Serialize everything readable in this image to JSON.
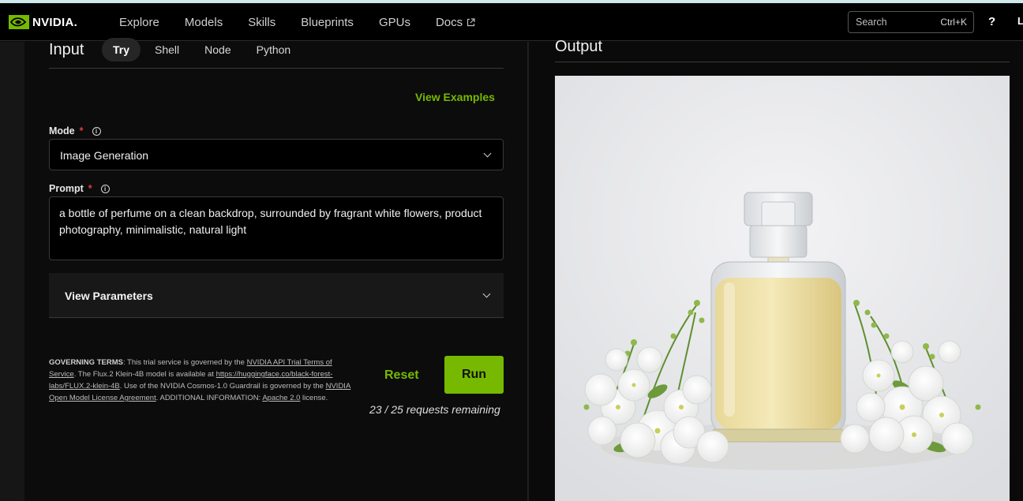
{
  "header": {
    "brand": "NVIDIA.",
    "nav": [
      "Explore",
      "Models",
      "Skills",
      "Blueprints",
      "GPUs",
      "Docs"
    ],
    "search_placeholder": "Search",
    "search_shortcut": "Ctrl+K",
    "help": "?",
    "user_initial": "L"
  },
  "input": {
    "title": "Input",
    "tabs": [
      "Try",
      "Shell",
      "Node",
      "Python"
    ],
    "active_tab": "Try",
    "view_examples": "View Examples",
    "mode_label": "Mode",
    "mode_value": "Image Generation",
    "prompt_label": "Prompt",
    "prompt_value": "a bottle of perfume on a clean backdrop, surrounded by fragrant white flowers, product photography, minimalistic, natural light",
    "required_mark": "*",
    "view_parameters": "View Parameters",
    "terms": {
      "heading": "GOVERNING TERMS",
      "t1": ": This trial service is governed by the ",
      "l1": "NVIDIA API Trial Terms of Service",
      "t2": ". The Flux.2 Klein-4B model is available at ",
      "l2": "https://huggingface.co/black-forest-labs/FLUX.2-klein-4B",
      "t3": ". Use of the NVIDIA Cosmos-1.0 Guardrail is governed by the ",
      "l3": "NVIDIA Open Model License Agreement",
      "t4": ". ADDITIONAL INFORMATION: ",
      "l4": "Apache 2.0",
      "t5": " license."
    },
    "reset_label": "Reset",
    "run_label": "Run",
    "requests_remaining": "23 / 25 requests remaining"
  },
  "output": {
    "title": "Output"
  },
  "colors": {
    "accent": "#76b900",
    "background": "#0a0a0a",
    "required": "#e23b3b"
  },
  "icons": [
    "nvidia-eye-logo",
    "external-link-icon",
    "info-icon",
    "chevron-down-icon"
  ]
}
